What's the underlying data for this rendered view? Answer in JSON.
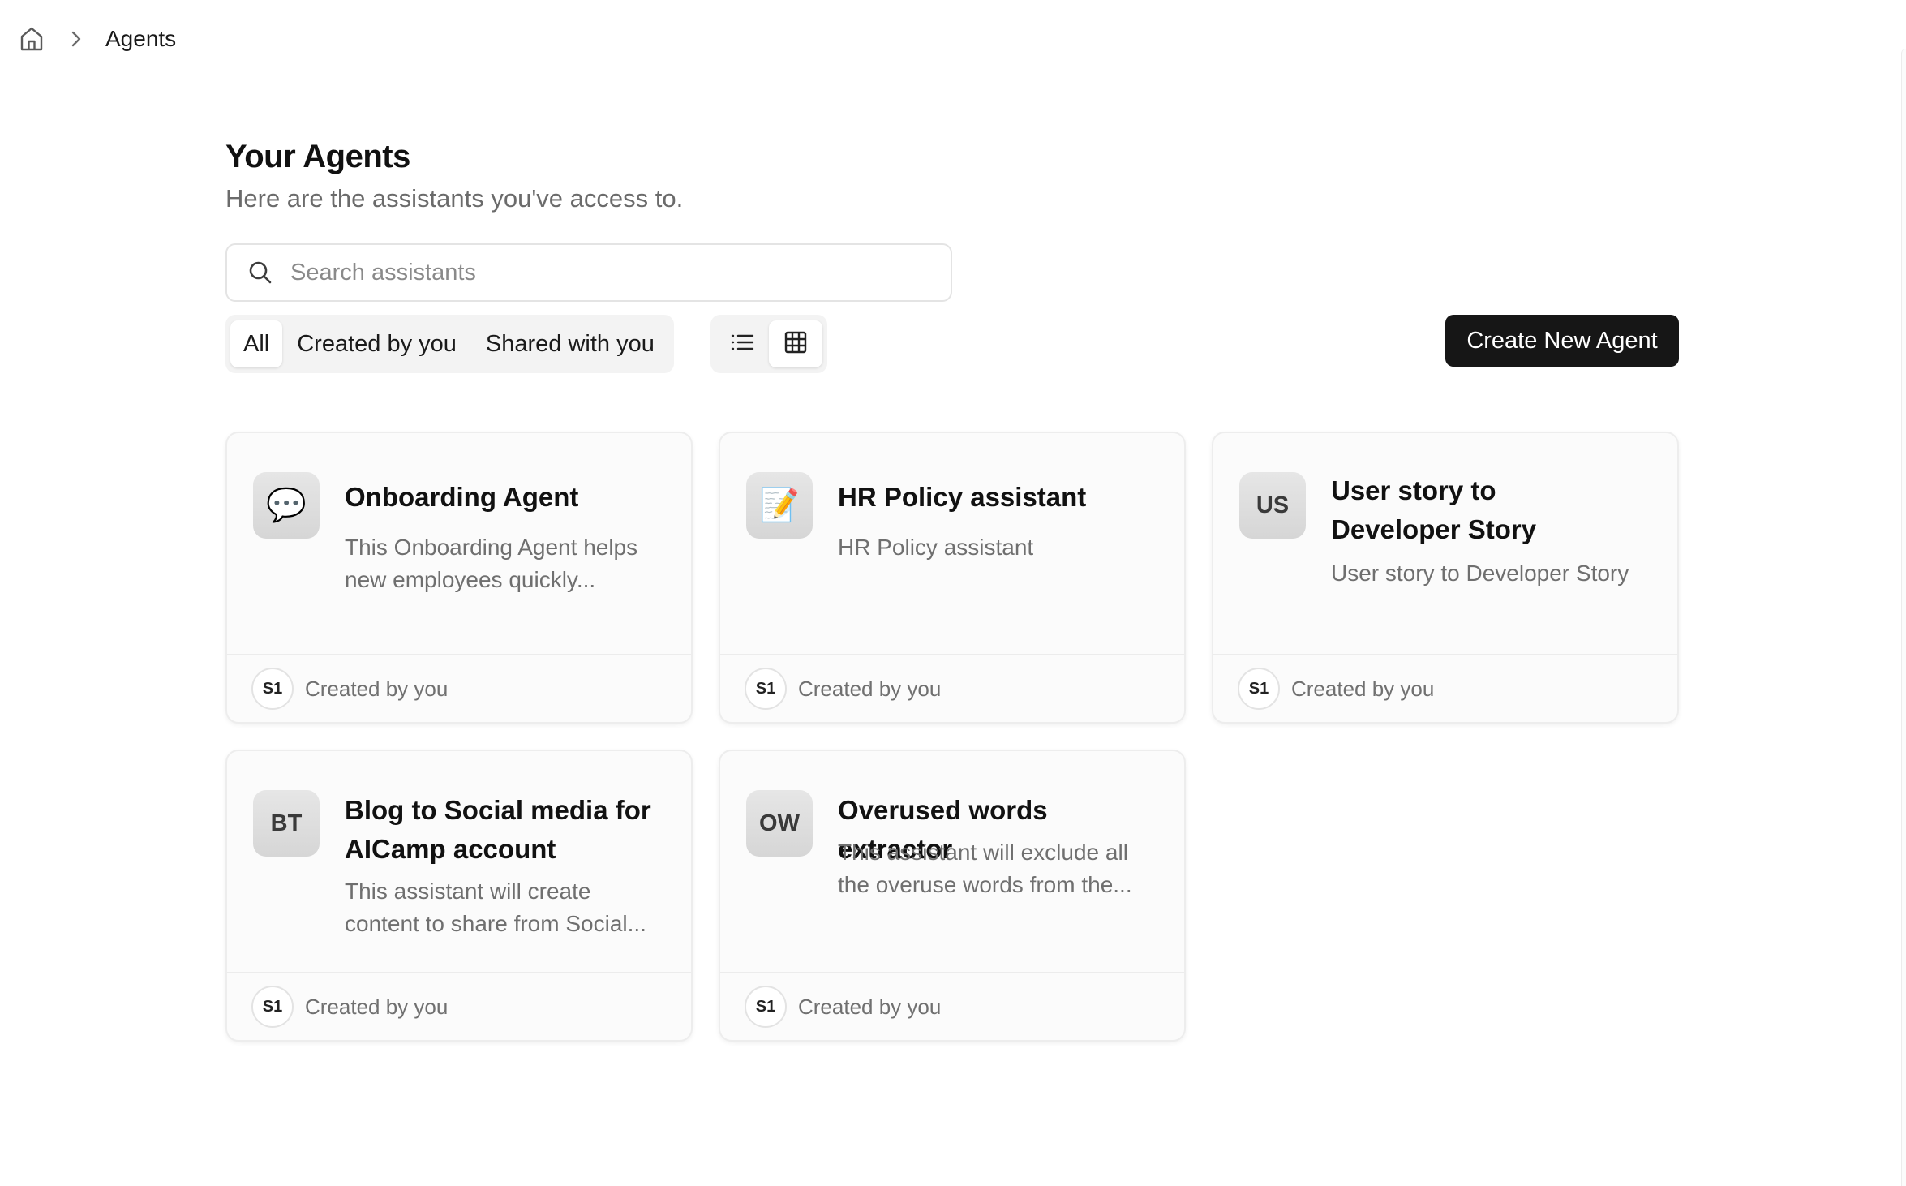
{
  "breadcrumb": {
    "home_icon": "home-icon",
    "separator_icon": "chevron-right-icon",
    "current": "Agents"
  },
  "header": {
    "title": "Your Agents",
    "subtitle": "Here are the assistants you've access to."
  },
  "search": {
    "icon": "search-icon",
    "placeholder": "Search assistants",
    "value": ""
  },
  "filters": {
    "selected": "All",
    "tabs": [
      "All",
      "Created by you",
      "Shared with you"
    ]
  },
  "view_toggle": {
    "options": [
      "list-icon",
      "grid-icon"
    ],
    "selected": "grid-icon"
  },
  "create_button": "Create New Agent",
  "agents": [
    {
      "avatar": "💬",
      "avatar_kind": "speech-bubble-icon",
      "title_lines": [
        "Onboarding Agent"
      ],
      "description_lines": [
        "This Onboarding Agent helps",
        "new employees quickly..."
      ],
      "owner_initials": "S1",
      "owner_label": "Created by you"
    },
    {
      "avatar": "📝",
      "avatar_kind": "memo-icon",
      "title_lines": [
        "HR Policy assistant"
      ],
      "description_lines": [
        "HR Policy assistant"
      ],
      "owner_initials": "S1",
      "owner_label": "Created by you"
    },
    {
      "avatar": "US",
      "avatar_kind": "initials",
      "title_lines": [
        "User story to",
        "Developer Story"
      ],
      "description_lines": [
        "User story to Developer Story"
      ],
      "owner_initials": "S1",
      "owner_label": "Created by you"
    },
    {
      "avatar": "BT",
      "avatar_kind": "initials",
      "title_lines": [
        "Blog to Social media for",
        "AICamp account"
      ],
      "description_lines": [
        "This assistant will create",
        "content to share from Social..."
      ],
      "owner_initials": "S1",
      "owner_label": "Created by you"
    },
    {
      "avatar": "OW",
      "avatar_kind": "initials",
      "title_lines": [
        "Overused words extractor"
      ],
      "description_lines": [
        "This assistant will exclude all",
        "the overuse words from the..."
      ],
      "owner_initials": "S1",
      "owner_label": "Created by you"
    }
  ]
}
